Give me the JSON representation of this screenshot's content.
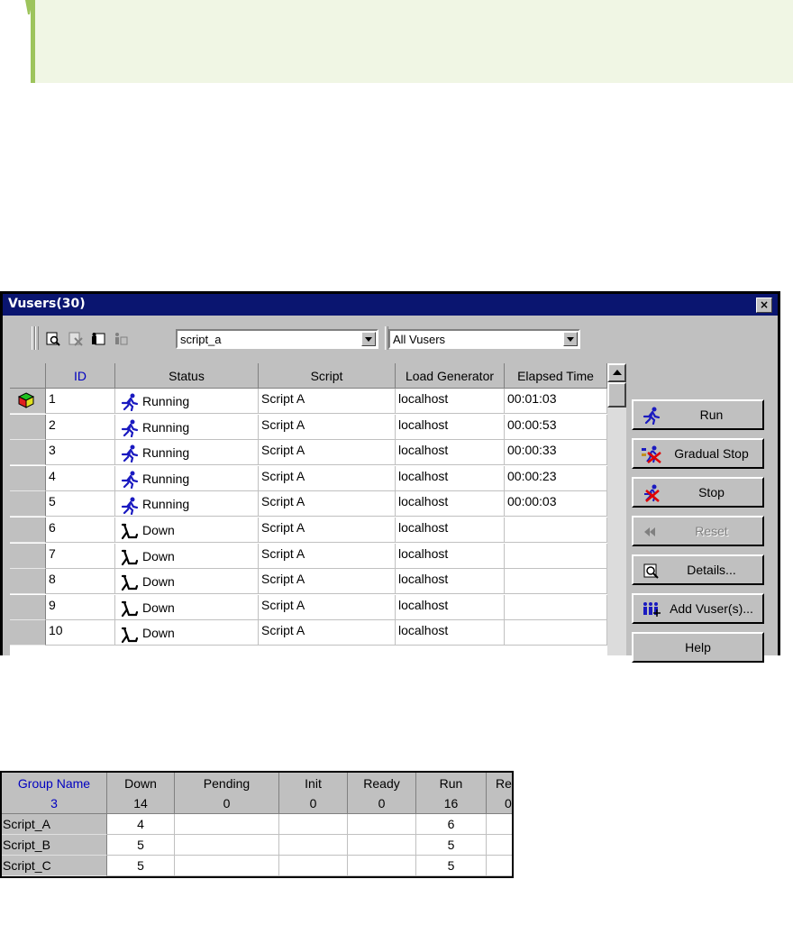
{
  "note": {
    "icon": "info-marker-icon",
    "accent": "#9dc45c",
    "background": "#f0f6e4"
  },
  "window": {
    "title": "Vusers(30)",
    "close_glyph": "×",
    "toolbar": {
      "script_filter": "script_a",
      "vuser_filter": "All Vusers"
    },
    "columns": {
      "rowhdr": "",
      "id": "ID",
      "status": "Status",
      "script": "Script",
      "load_generator": "Load Generator",
      "elapsed": "Elapsed Time"
    },
    "rows": [
      {
        "id": "1",
        "status": "Running",
        "script": "Script A",
        "lg": "localhost",
        "elapsed": "00:01:03"
      },
      {
        "id": "2",
        "status": "Running",
        "script": "Script A",
        "lg": "localhost",
        "elapsed": "00:00:53"
      },
      {
        "id": "3",
        "status": "Running",
        "script": "Script A",
        "lg": "localhost",
        "elapsed": "00:00:33"
      },
      {
        "id": "4",
        "status": "Running",
        "script": "Script A",
        "lg": "localhost",
        "elapsed": "00:00:23"
      },
      {
        "id": "5",
        "status": "Running",
        "script": "Script A",
        "lg": "localhost",
        "elapsed": "00:00:03"
      },
      {
        "id": "6",
        "status": "Down",
        "script": "Script A",
        "lg": "localhost",
        "elapsed": ""
      },
      {
        "id": "7",
        "status": "Down",
        "script": "Script A",
        "lg": "localhost",
        "elapsed": ""
      },
      {
        "id": "8",
        "status": "Down",
        "script": "Script A",
        "lg": "localhost",
        "elapsed": ""
      },
      {
        "id": "9",
        "status": "Down",
        "script": "Script A",
        "lg": "localhost",
        "elapsed": ""
      },
      {
        "id": "10",
        "status": "Down",
        "script": "Script A",
        "lg": "localhost",
        "elapsed": ""
      }
    ],
    "buttons": {
      "run": "Run",
      "gradual_stop": "Gradual Stop",
      "stop": "Stop",
      "reset": "Reset",
      "details": "Details...",
      "add_vusers": "Add Vuser(s)...",
      "help": "Help"
    }
  },
  "groups": {
    "headers": [
      {
        "label": "Group Name",
        "count": "3"
      },
      {
        "label": "Down",
        "count": "14"
      },
      {
        "label": "Pending",
        "count": "0"
      },
      {
        "label": "Init",
        "count": "0"
      },
      {
        "label": "Ready",
        "count": "0"
      },
      {
        "label": "Run",
        "count": "16"
      },
      {
        "label": "Rende",
        "count": "0"
      }
    ],
    "rows": [
      {
        "name": "Script_A",
        "down": "4",
        "run": "6"
      },
      {
        "name": "Script_B",
        "down": "5",
        "run": "5"
      },
      {
        "name": "Script_C",
        "down": "5",
        "run": "5"
      }
    ]
  }
}
